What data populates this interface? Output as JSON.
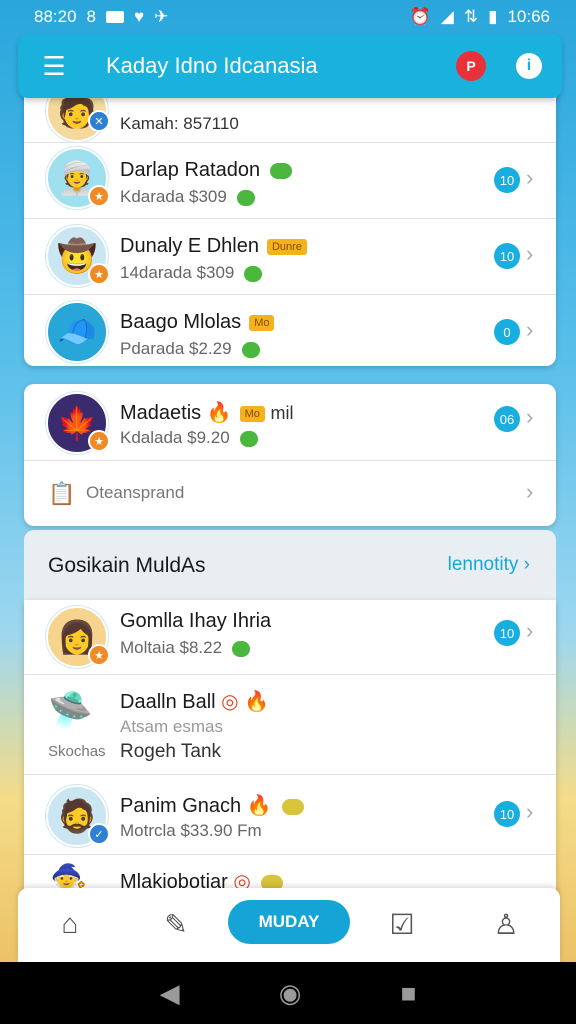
{
  "status_bar": {
    "time_left": "88:20",
    "indicator": "8",
    "time_right": "10:66"
  },
  "app_bar": {
    "title": "Kaday Idno Idcanasia",
    "notif_badge": "P",
    "info_icon": "i"
  },
  "card1": {
    "partial_sub": "Kamah: 857110",
    "rows": [
      {
        "name": "Darlap Ratadon",
        "sub": "Kdarada $309",
        "count": "10",
        "emoji": "👳"
      },
      {
        "name": "Dunaly E Dhlen",
        "tag": "Dunre",
        "sub": "14darada $309",
        "count": "10",
        "emoji": "🤠"
      },
      {
        "name": "Baago Mlolas",
        "tag": "Mo",
        "sub": "Pdarada $2.29",
        "count": "0",
        "emoji": "🧢"
      }
    ]
  },
  "card2": {
    "row": {
      "name": "Madaetis",
      "tag": "Mo",
      "name_suffix": "mil",
      "sub": "Kdalada $9.20",
      "count": "06",
      "emoji": "🍁"
    },
    "extra_label": "Oteansprand"
  },
  "section": {
    "title": "Gosikain MuldAs",
    "link": "lennotity"
  },
  "list": [
    {
      "name": "Gomlla Ihay Ihria",
      "sub": "Moltaia $8.22",
      "count": "10",
      "emoji": "👩"
    },
    {
      "name": "Daalln Ball",
      "sub": "Atsam esmas",
      "sub2_left": "Skochas",
      "sub2": "Rogeh Tank",
      "emoji": "🛸"
    },
    {
      "name": "Panim Gnach",
      "sub": "Motrcla $33.90 Fm",
      "count": "10",
      "emoji": "🧔"
    },
    {
      "name": "Mlakiobotiar",
      "emoji": "🧙"
    }
  ],
  "bottom_nav": {
    "home_icon": "home-icon",
    "pill_label": "MUDAY"
  },
  "colors": {
    "accent": "#1bb1dd",
    "badge": "#19aee0",
    "green": "#49b83c"
  }
}
